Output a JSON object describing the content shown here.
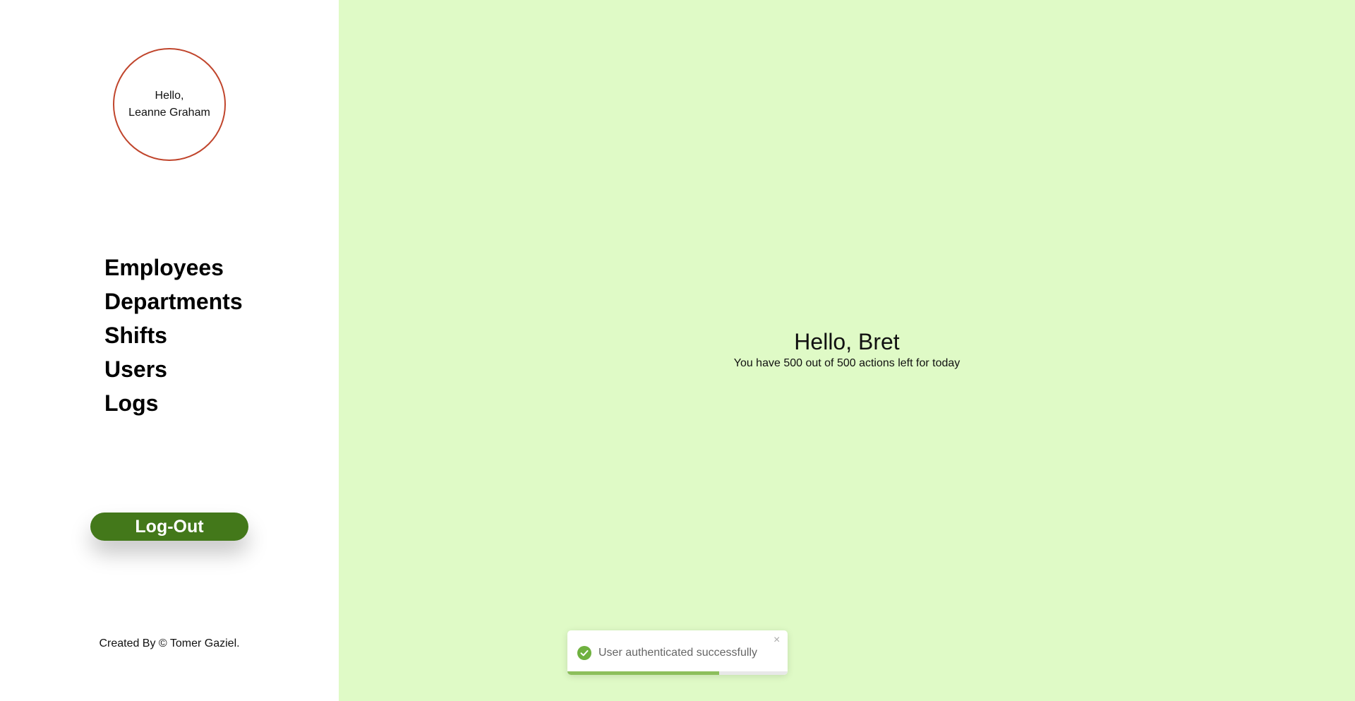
{
  "sidebar": {
    "avatar": {
      "greeting": "Hello,",
      "name": "Leanne Graham",
      "border_color": "#c0452c"
    },
    "nav_items": [
      {
        "label": "Employees"
      },
      {
        "label": "Departments"
      },
      {
        "label": "Shifts"
      },
      {
        "label": "Users"
      },
      {
        "label": "Logs"
      }
    ],
    "logout_label": "Log-Out",
    "logout_color": "#43781a",
    "footer": "Created By © Tomer Gaziel."
  },
  "main": {
    "background": "#dffac6",
    "title": "Hello, Bret",
    "subtitle": "You have 500 out of 500 actions left for today"
  },
  "toast": {
    "icon": "check-circle-icon",
    "message": "User authenticated successfully",
    "close_glyph": "×",
    "progress_fraction": 0.69,
    "accent": "#6fb13f"
  }
}
